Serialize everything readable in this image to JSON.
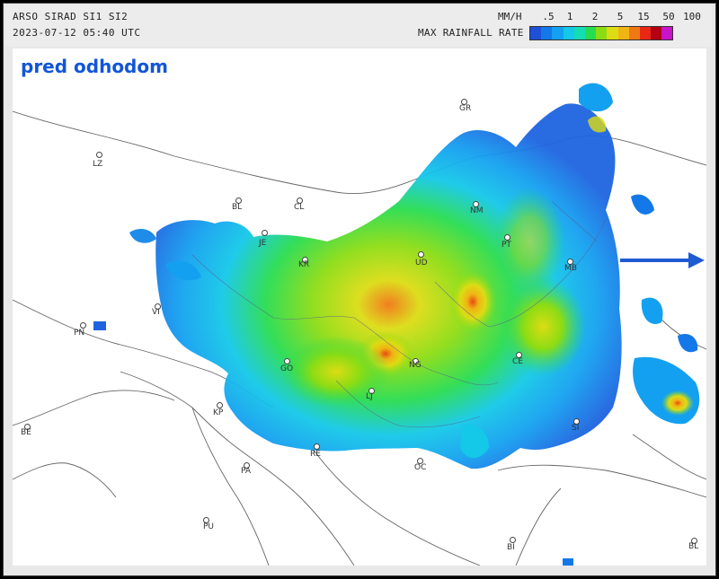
{
  "header": {
    "title": "ARSO SIRAD SI1 SI2",
    "timestamp": "2023-07-12 05:40 UTC",
    "unit": "MM/H",
    "legend_title": "MAX RAINFALL RATE",
    "scale_ticks": [
      ".5",
      "1",
      "2",
      "5",
      "15",
      "50",
      "100"
    ],
    "scale_colors": [
      "#1e50d8",
      "#1478e8",
      "#14a0f0",
      "#14c8e8",
      "#14dcb4",
      "#28dc50",
      "#8cdc14",
      "#dcdc14",
      "#f0b414",
      "#f07814",
      "#e82814",
      "#b40014",
      "#c814c8"
    ]
  },
  "caption": "pred odhodom",
  "arrow": {
    "color": "#1e5ad2",
    "icon": "arrow-right-icon"
  },
  "cities": [
    {
      "code": "GR"
    },
    {
      "code": "LZ"
    },
    {
      "code": "BL"
    },
    {
      "code": "CL"
    },
    {
      "code": "JE"
    },
    {
      "code": "KR"
    },
    {
      "code": "NM"
    },
    {
      "code": "PT"
    },
    {
      "code": "UD"
    },
    {
      "code": "PN"
    },
    {
      "code": "GO"
    },
    {
      "code": "LJ"
    },
    {
      "code": "VI"
    },
    {
      "code": "NG"
    },
    {
      "code": "CE"
    },
    {
      "code": "KP"
    },
    {
      "code": "MB"
    },
    {
      "code": "RE"
    },
    {
      "code": "PA"
    },
    {
      "code": "OC"
    },
    {
      "code": "SI"
    },
    {
      "code": "PU"
    },
    {
      "code": "BI"
    },
    {
      "code": "BL"
    },
    {
      "code": "BE"
    }
  ]
}
